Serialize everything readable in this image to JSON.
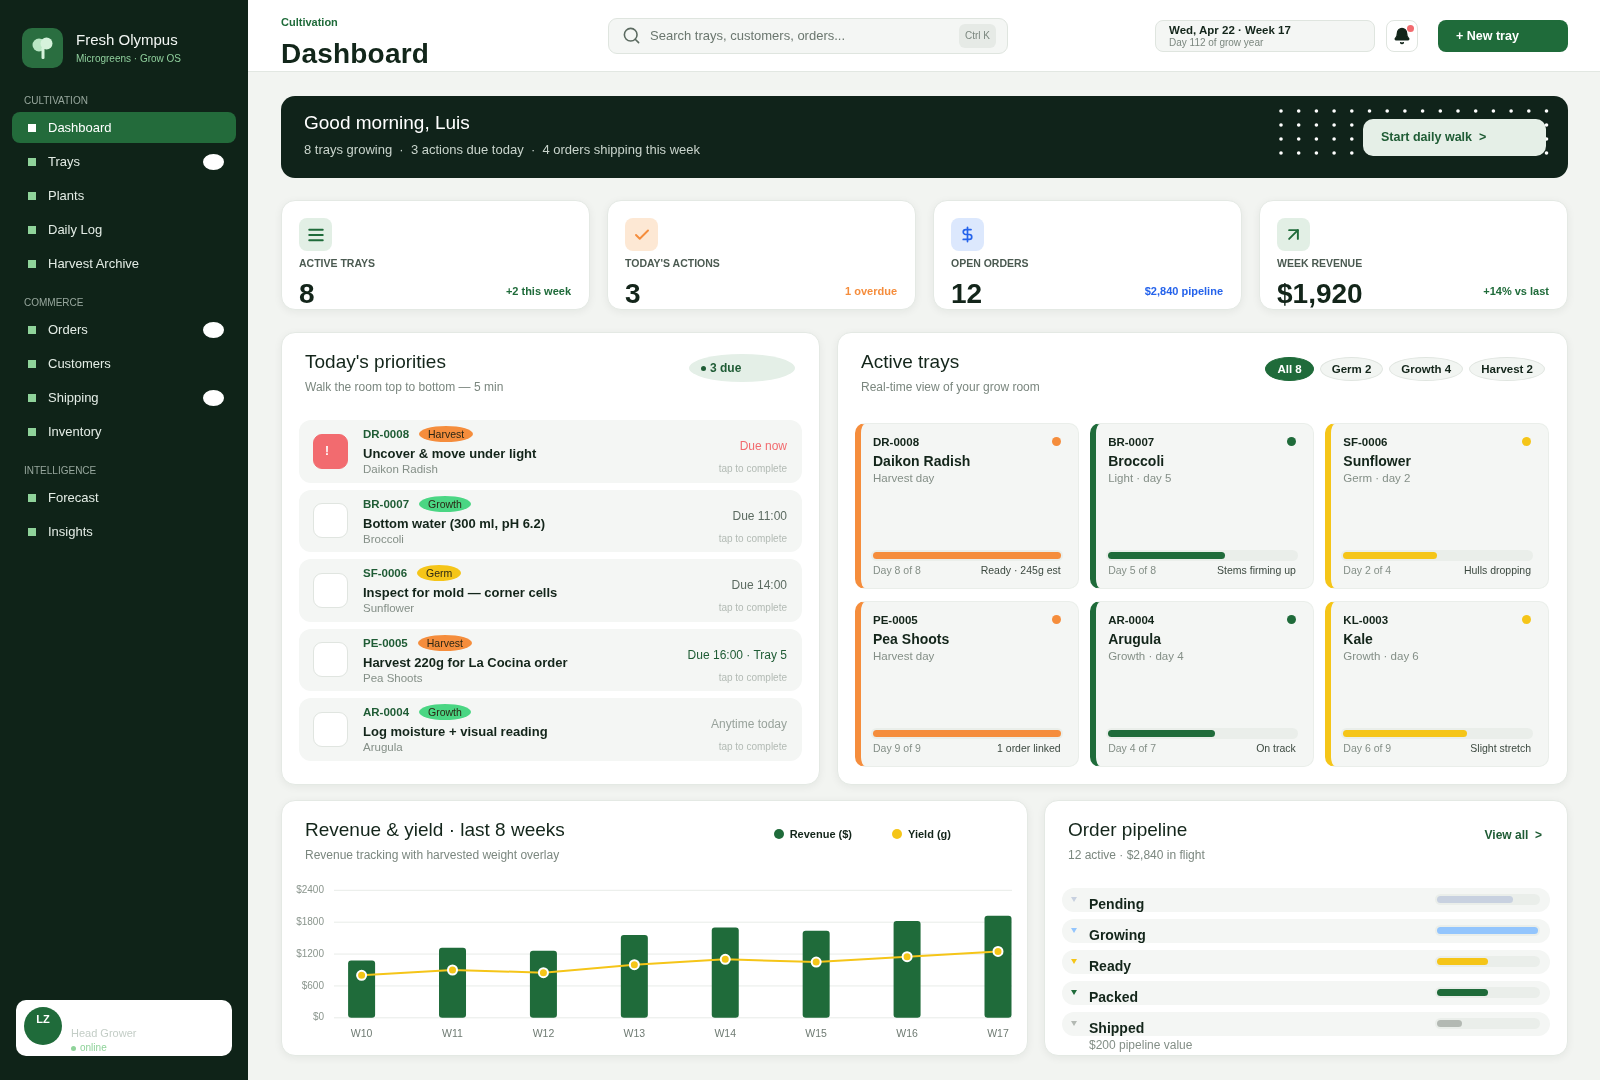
{
  "sidebar": {
    "brand": {
      "name": "Fresh Olympus",
      "tagline": "Microgreens · Grow OS"
    },
    "sections": [
      {
        "label": "CULTIVATION",
        "items": [
          {
            "label": "Dashboard",
            "selected": true,
            "badge": false
          },
          {
            "label": "Trays",
            "selected": false,
            "badge": true
          },
          {
            "label": "Plants",
            "selected": false,
            "badge": false
          },
          {
            "label": "Daily Log",
            "selected": false,
            "badge": false
          },
          {
            "label": "Harvest Archive",
            "selected": false,
            "badge": false
          }
        ]
      },
      {
        "label": "COMMERCE",
        "items": [
          {
            "label": "Orders",
            "selected": false,
            "badge": true
          },
          {
            "label": "Customers",
            "selected": false,
            "badge": false
          },
          {
            "label": "Shipping",
            "selected": false,
            "badge": true
          },
          {
            "label": "Inventory",
            "selected": false,
            "badge": false
          }
        ]
      },
      {
        "label": "INTELLIGENCE",
        "items": [
          {
            "label": "Forecast",
            "selected": false,
            "badge": false
          },
          {
            "label": "Insights",
            "selected": false,
            "badge": false
          }
        ]
      }
    ],
    "user": {
      "initials": "LZ",
      "role": "Head Grower",
      "status": "online",
      "online": true
    }
  },
  "header": {
    "breadcrumb": "Cultivation",
    "title": "Dashboard",
    "search": {
      "placeholder": "Search trays, customers, orders...",
      "shortcut": "Ctrl K"
    },
    "date": {
      "label": "Wed, Apr 22 · Week 17",
      "sub": "Day 112 of grow year"
    },
    "notifications": {
      "unread": true
    },
    "new_button": "+ New tray"
  },
  "banner": {
    "greeting": "Good morning, Luis",
    "summary": "8 trays growing  ·  3 actions due today  ·  4 orders shipping this week",
    "action": "Start daily walk  >"
  },
  "stats": [
    {
      "kind": "trays",
      "label": "ACTIVE TRAYS",
      "value": "8",
      "delta": "+2 this week",
      "color": "#1f6b3a"
    },
    {
      "kind": "actions",
      "label": "TODAY'S ACTIONS",
      "value": "3",
      "delta": "1 overdue",
      "color": "#f58d3c"
    },
    {
      "kind": "orders",
      "label": "OPEN ORDERS",
      "value": "12",
      "delta": "$2,840 pipeline",
      "color": "#2563eb"
    },
    {
      "kind": "revenue",
      "label": "WEEK REVENUE",
      "value": "$1,920",
      "delta": "+14% vs last",
      "color": "#1f6b3a"
    }
  ],
  "priorities": {
    "title": "Today's priorities",
    "subtitle": "Walk the room top to bottom — 5 min",
    "badge": "3 due",
    "tasks": [
      {
        "id": "DR-0008",
        "tag": {
          "label": "Harvest",
          "color": "#f58d3c"
        },
        "title": "Uncover & move under light",
        "plant": "Daikon Radish",
        "due": {
          "text": "Due now",
          "color": "#f26b6f"
        },
        "hint": "tap to complete",
        "overdue": true,
        "marker": "!"
      },
      {
        "id": "BR-0007",
        "tag": {
          "label": "Growth",
          "color": "#4ad683"
        },
        "title": "Bottom water (300 ml, pH 6.2)",
        "plant": "Broccoli",
        "due": {
          "text": "Due 11:00",
          "color": "#5c6b61"
        },
        "hint": "tap to complete",
        "overdue": false
      },
      {
        "id": "SF-0006",
        "tag": {
          "label": "Germ",
          "color": "#f5c518"
        },
        "title": "Inspect for mold — corner cells",
        "plant": "Sunflower",
        "due": {
          "text": "Due 14:00",
          "color": "#5c6b61"
        },
        "hint": "tap to complete",
        "overdue": false
      },
      {
        "id": "PE-0005",
        "tag": {
          "label": "Harvest",
          "color": "#f58d3c"
        },
        "title": "Harvest 220g for La Cocina order",
        "plant": "Pea Shoots",
        "due": {
          "text": "Due 16:00 · Tray 5",
          "color": "#1f5c35"
        },
        "hint": "tap to complete",
        "overdue": false
      },
      {
        "id": "AR-0004",
        "tag": {
          "label": "Growth",
          "color": "#4ad683"
        },
        "title": "Log moisture + visual reading",
        "plant": "Arugula",
        "due": {
          "text": "Anytime today",
          "color": "#99a39c"
        },
        "hint": "tap to complete",
        "overdue": false
      }
    ]
  },
  "trays": {
    "title": "Active trays",
    "subtitle": "Real-time view of your grow room",
    "filters": [
      {
        "label": "All 8",
        "selected": true
      },
      {
        "label": "Germ 2",
        "selected": false
      },
      {
        "label": "Growth 4",
        "selected": false
      },
      {
        "label": "Harvest 2",
        "selected": false
      }
    ],
    "items": [
      {
        "id": "DR-0008",
        "name": "Daikon Radish",
        "stage": "Harvest day",
        "color": "#f58d3c",
        "level": 1,
        "day": "Day 8 of 8",
        "note": "Ready · 245g est"
      },
      {
        "id": "BR-0007",
        "name": "Broccoli",
        "stage": "Light · day 5",
        "color": "#1f6b3a",
        "level": 0.62,
        "day": "Day 5 of 8",
        "note": "Stems firming up"
      },
      {
        "id": "SF-0006",
        "name": "Sunflower",
        "stage": "Germ · day 2",
        "color": "#f5c518",
        "level": 0.5,
        "day": "Day 2 of 4",
        "note": "Hulls dropping"
      },
      {
        "id": "PE-0005",
        "name": "Pea Shoots",
        "stage": "Harvest day",
        "color": "#f58d3c",
        "level": 1,
        "day": "Day 9 of 9",
        "note": "1 order linked"
      },
      {
        "id": "AR-0004",
        "name": "Arugula",
        "stage": "Growth · day 4",
        "color": "#1f6b3a",
        "level": 0.57,
        "day": "Day 4 of 7",
        "note": "On track"
      },
      {
        "id": "KL-0003",
        "name": "Kale",
        "stage": "Growth · day 6",
        "color": "#f5c518",
        "level": 0.66,
        "day": "Day 6 of 9",
        "note": "Slight stretch"
      }
    ]
  },
  "revenue": {
    "title": "Revenue & yield · last 8 weeks",
    "subtitle": "Revenue tracking with harvested weight overlay",
    "chart_data": {
      "type": "bar",
      "categories": [
        "W10",
        "W11",
        "W12",
        "W13",
        "W14",
        "W15",
        "W16",
        "W17"
      ],
      "series": [
        {
          "name": "Revenue ($)",
          "color": "#1f6b3a",
          "values": [
            1080,
            1320,
            1260,
            1560,
            1700,
            1640,
            1820,
            1920
          ]
        },
        {
          "name": "Yield (g)",
          "color": "#f5c518",
          "type": "line",
          "marker": "circle",
          "values": [
            800,
            900,
            850,
            1000,
            1100,
            1050,
            1150,
            1250
          ]
        }
      ],
      "ylim": [
        0,
        2400
      ],
      "yticks": [
        {
          "value": 0,
          "label": "$0"
        },
        {
          "value": 600,
          "label": "$600"
        },
        {
          "value": 1200,
          "label": "$1200"
        },
        {
          "value": 1800,
          "label": "$1800"
        },
        {
          "value": 2400,
          "label": "$2400"
        }
      ],
      "grid": true
    }
  },
  "pipeline": {
    "title": "Order pipeline",
    "subtitle": "12 active · $2,840 in flight",
    "link": "View all  >",
    "stages": [
      {
        "label": "Pending",
        "color": "#c8d1e0",
        "level": 0.75
      },
      {
        "label": "Growing",
        "color": "#93c5fd",
        "level": 1
      },
      {
        "label": "Ready",
        "color": "#f5c518",
        "level": 0.5
      },
      {
        "label": "Packed",
        "color": "#1f6b3a",
        "level": 0.5
      },
      {
        "label": "Shipped",
        "color": "#b3b9b3",
        "level": 0.25,
        "sub": "$200 pipeline value"
      }
    ]
  }
}
